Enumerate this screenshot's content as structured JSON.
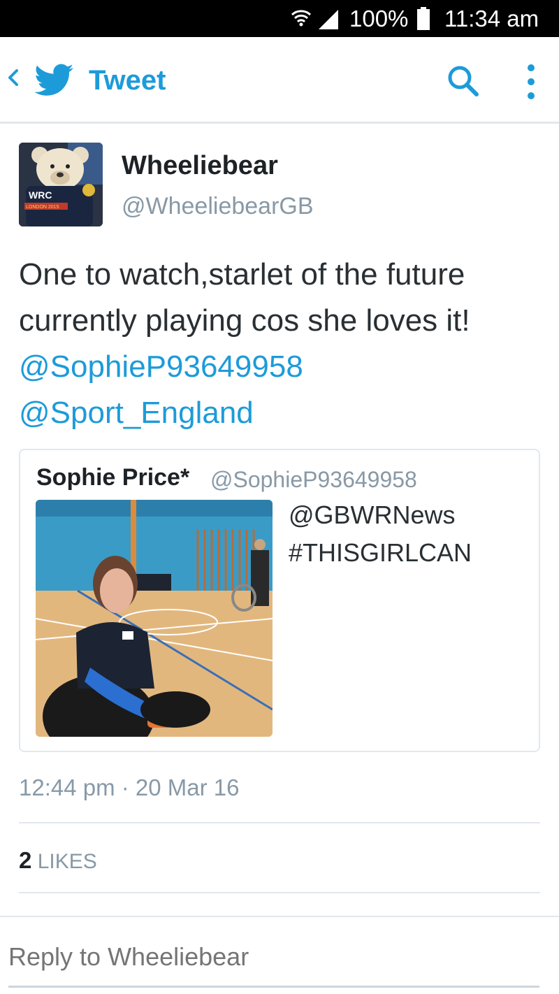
{
  "status_bar": {
    "battery_percent": "100%",
    "time": "11:34 am",
    "icons": [
      "wifi-icon",
      "signal-icon",
      "battery-icon"
    ]
  },
  "header": {
    "back_icon": "chevron-left-icon",
    "logo_icon": "twitter-bird-icon",
    "title": "Tweet",
    "search_icon": "search-icon",
    "more_icon": "more-vertical-icon"
  },
  "tweet": {
    "author_name": "Wheeliebear",
    "author_handle": "@WheeliebearGB",
    "avatar_badge": "WRC",
    "avatar_sub": "LONDON 2015",
    "text_lines": [
      "One to watch,starlet of the future",
      "currently playing cos she loves it!"
    ],
    "mentions": [
      "@SophieP93649958",
      "@Sport_England"
    ],
    "quoted": {
      "name": "Sophie Price*",
      "handle": "@SophieP93649958",
      "text_lines": [
        "@GBWRNews",
        "#THISGIRLCAN"
      ]
    },
    "timestamp": "12:44 pm · 20 Mar 16",
    "likes_count": "2",
    "likes_label": "LIKES"
  },
  "reply": {
    "placeholder": "Reply to Wheeliebear"
  },
  "colors": {
    "brand_blue": "#1d9bd9",
    "muted_grey": "#8899a6",
    "divider": "#e1e8ed"
  }
}
